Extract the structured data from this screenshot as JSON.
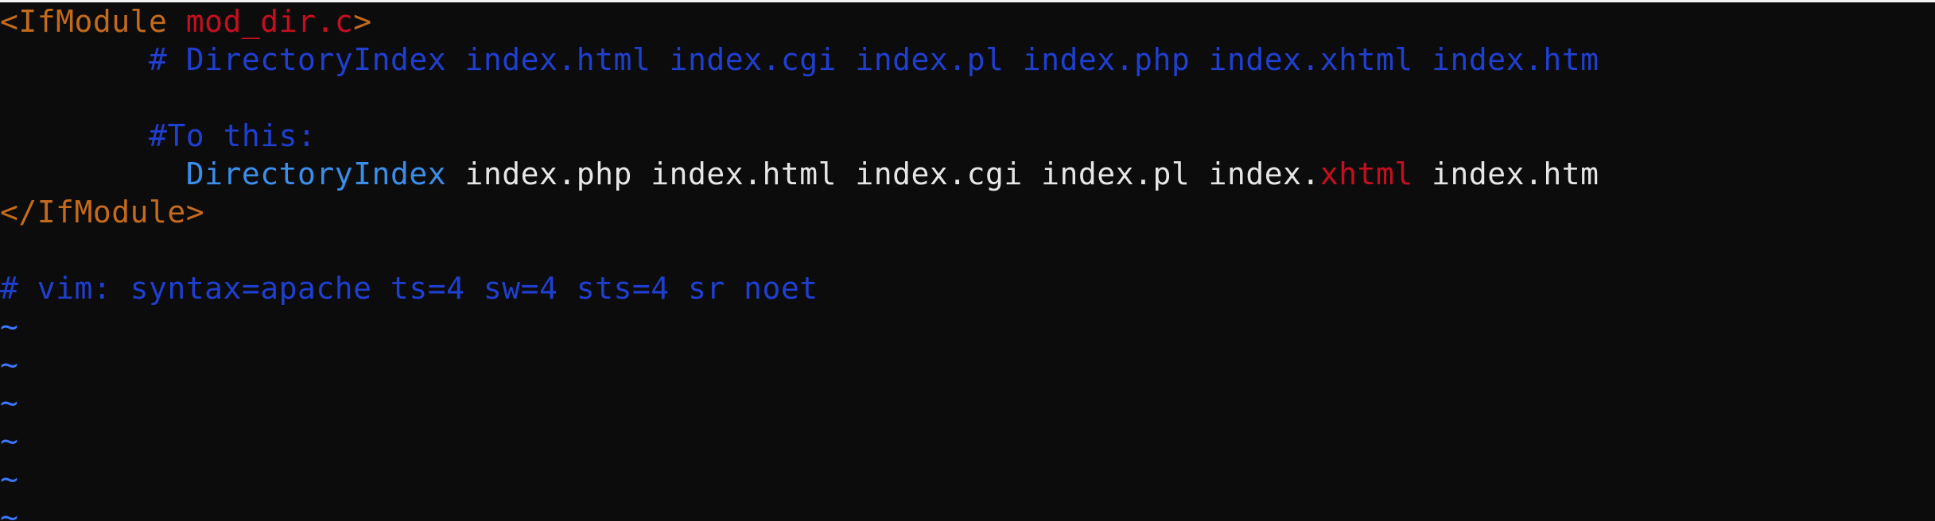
{
  "editor": {
    "lines": {
      "l1": {
        "tag_open": "<IfModule",
        "module": "mod_dir.c",
        "close": ">"
      },
      "l2": {
        "indent": "        ",
        "comment": "# DirectoryIndex index.html index.cgi index.pl index.php index.xhtml index.htm"
      },
      "l3": {
        "text": ""
      },
      "l4": {
        "indent": "        ",
        "comment": "#To this:"
      },
      "l5": {
        "indent": "          ",
        "directive": "DirectoryIndex",
        "args_a": " index.php index.html index.cgi index.pl index.",
        "args_hl": "xhtml",
        "args_b": " index.htm"
      },
      "l6": {
        "tag": "</IfModule>"
      },
      "l7": {
        "text": ""
      },
      "l8": {
        "comment": "# vim: syntax=apache ts=4 sw=4 sts=4 sr noet"
      }
    },
    "empty_marker": "~"
  },
  "colors": {
    "background": "#0c0c0c",
    "tag": "#c46a1c",
    "module": "#c50f1f",
    "comment": "#1f3fd1",
    "directive": "#3b8eea",
    "text": "#e6e6e6",
    "tilde": "#3b78ff"
  }
}
